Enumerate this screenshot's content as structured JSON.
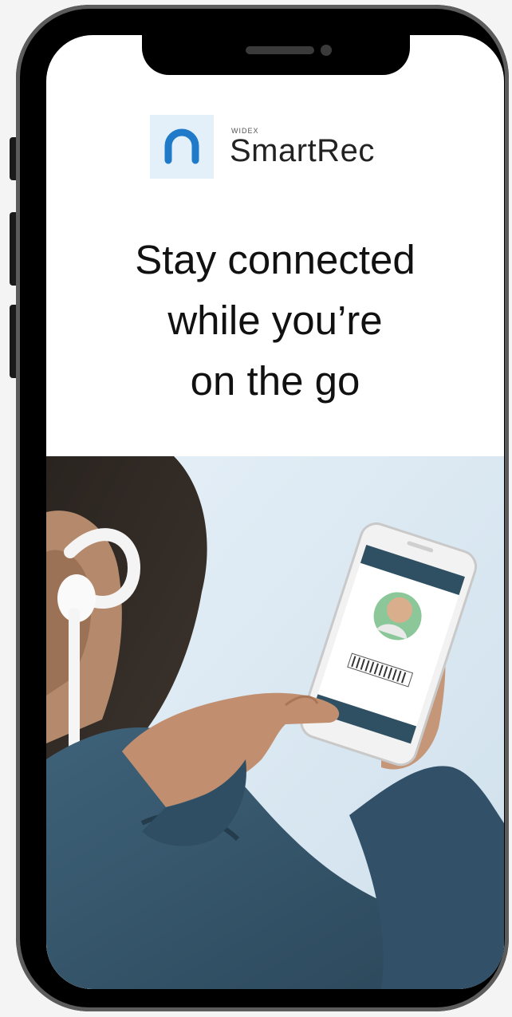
{
  "brand": {
    "sub_label": "WIDEX",
    "name": "SmartRec",
    "accent_color": "#1f7ac9",
    "icon": "smartrec-logo-icon"
  },
  "headline": {
    "line1": "Stay connected",
    "line2": "while you’re",
    "line3": "on the go"
  },
  "hero": {
    "background_color": "#dce9f3",
    "jacket_color": "#34556b",
    "device_icon": "earbud-hearing-aid-icon"
  }
}
